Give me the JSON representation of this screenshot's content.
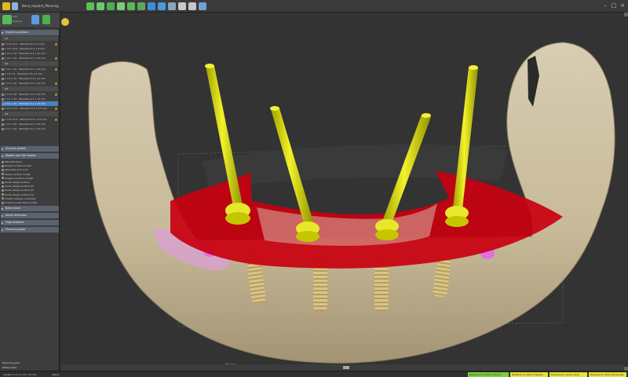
{
  "window": {
    "title": "Bone_Implant_Planning",
    "controls": {
      "minimize": "–",
      "maximize": "□",
      "close": "×"
    }
  },
  "quick_access": [
    {
      "icon": "app-logo-icon",
      "color": "#e6b820"
    },
    {
      "icon": "new-icon",
      "color": "#8fb0d8"
    },
    {
      "icon": "open-icon",
      "color": "#d8b070"
    },
    {
      "icon": "save-icon",
      "color": "#7aa7d8"
    }
  ],
  "ribbon_icons": [
    {
      "icon": "segment-icon",
      "color": "#5bbf5b"
    },
    {
      "icon": "teeth-icon",
      "color": "#6ec86e"
    },
    {
      "icon": "implant-icon",
      "color": "#4fae4f"
    },
    {
      "icon": "sleeve-icon",
      "color": "#7acb7a"
    },
    {
      "icon": "guide-icon",
      "color": "#58b858"
    },
    {
      "icon": "export-icon",
      "color": "#5ea85e"
    },
    {
      "icon": "move-icon",
      "color": "#3c8fd6"
    },
    {
      "icon": "rotate-icon",
      "color": "#4a9ae0"
    },
    {
      "icon": "view-icon",
      "color": "#8aa4c0"
    },
    {
      "icon": "measure-icon",
      "color": "#c8c8c8"
    },
    {
      "icon": "angle-icon",
      "color": "#c8c8c8"
    },
    {
      "icon": "info-icon",
      "color": "#6fa0d8"
    }
  ],
  "left_panel": {
    "tools": [
      {
        "label": "Add",
        "color": "#57b957"
      },
      {
        "label": "Remove",
        "color": "#d84a4a"
      },
      {
        "label": "Edit",
        "color": "#5b9be0"
      },
      {
        "label": "Check",
        "color": "#4fb04f"
      }
    ],
    "sections": {
      "implants": "Implant positions",
      "surgical_guides": "Surgical guides",
      "models": "Models and 3D models",
      "bone_level": "Bone Level",
      "nerve": "Nerve detection",
      "segmentation": "Segmentation",
      "planning": "Planning guide"
    },
    "groups": [
      "Q1",
      "Q2",
      "Q3",
      "Q4"
    ],
    "implant_rows": [
      "1 3.5 x 8.5 - Standard 4.1 x 8 mm",
      "1 3.5 x 8.5 - Standard 4.1 x 8 mm",
      "1 3.5 x 10 - Standard 4.1 x 10 mm",
      "1 4.1 x 10 - Standard 4.1 x 10 mm",
      "1 4.1 x 10 - Standard 4.1 x 10 mm",
      "1 3.5 x 8 - Standard 3.5 x 8 mm",
      "1 3.5 x 10 - Standard 3.5 x 10 mm",
      "1 3.5 x 10 - Standard 3.5 x 10 mm",
      "1 3.5 x 10 - Standard 3.5 x 10 mm",
      "1 4.1 x 10 - Standard 4.1 x 10 mm",
      "1 4.1 x 10 - Standard 4.1 x 10 mm",
      "1 3.5 x 8.5 - Standard 3.5 x 8.5 mm",
      "1 3.5 x 8.5 - Standard 3.5 x 8.5 mm",
      "1 4.1 x 10 - Standard 4.1 x 10 mm",
      "1 4.1 x 10 - Standard 4.1 x 10 mm"
    ],
    "model_rows": [
      "Mandible bone",
      "Gingiva surface model",
      "Opposing arch scan",
      "Sleeve surface model",
      "Implant positions model",
      "Guide design surface",
      "Guide design surface (2)",
      "Guide design surface (3)",
      "Guide design surface (4)",
      "Implant sleeves combined",
      "Surgical guide (final model)"
    ],
    "bottom": [
      "Planning guide",
      "Patient data"
    ]
  },
  "viewport": {
    "scale_label": "50 mm"
  },
  "statusbar": {
    "left": "Implant 4 of 4 | 3.5 x 10 mm",
    "mid": "Status",
    "right_green": "Distance to nerve: 4.8 mm",
    "right_y1": "Distance to other implants",
    "right_y2": "Distance to nerve canal",
    "right_y3": "Distance to other structures"
  }
}
